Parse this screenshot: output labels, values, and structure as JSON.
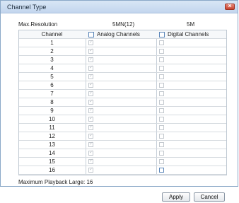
{
  "window": {
    "title": "Channel Type"
  },
  "labels": {
    "max_resolution": "Max.Resolution",
    "analog_resolution": "5MN(12)",
    "digital_resolution": "5M",
    "channel_header": "Channel",
    "analog_channels": "Analog Channels",
    "digital_channels": "Digital Channels",
    "max_playback": "Maximum Playback Large: 16"
  },
  "channels": [
    "1",
    "2",
    "3",
    "4",
    "5",
    "6",
    "7",
    "8",
    "9",
    "10",
    "11",
    "12",
    "13",
    "14",
    "15",
    "16"
  ],
  "buttons": {
    "apply": "Apply",
    "cancel": "Cancel"
  }
}
